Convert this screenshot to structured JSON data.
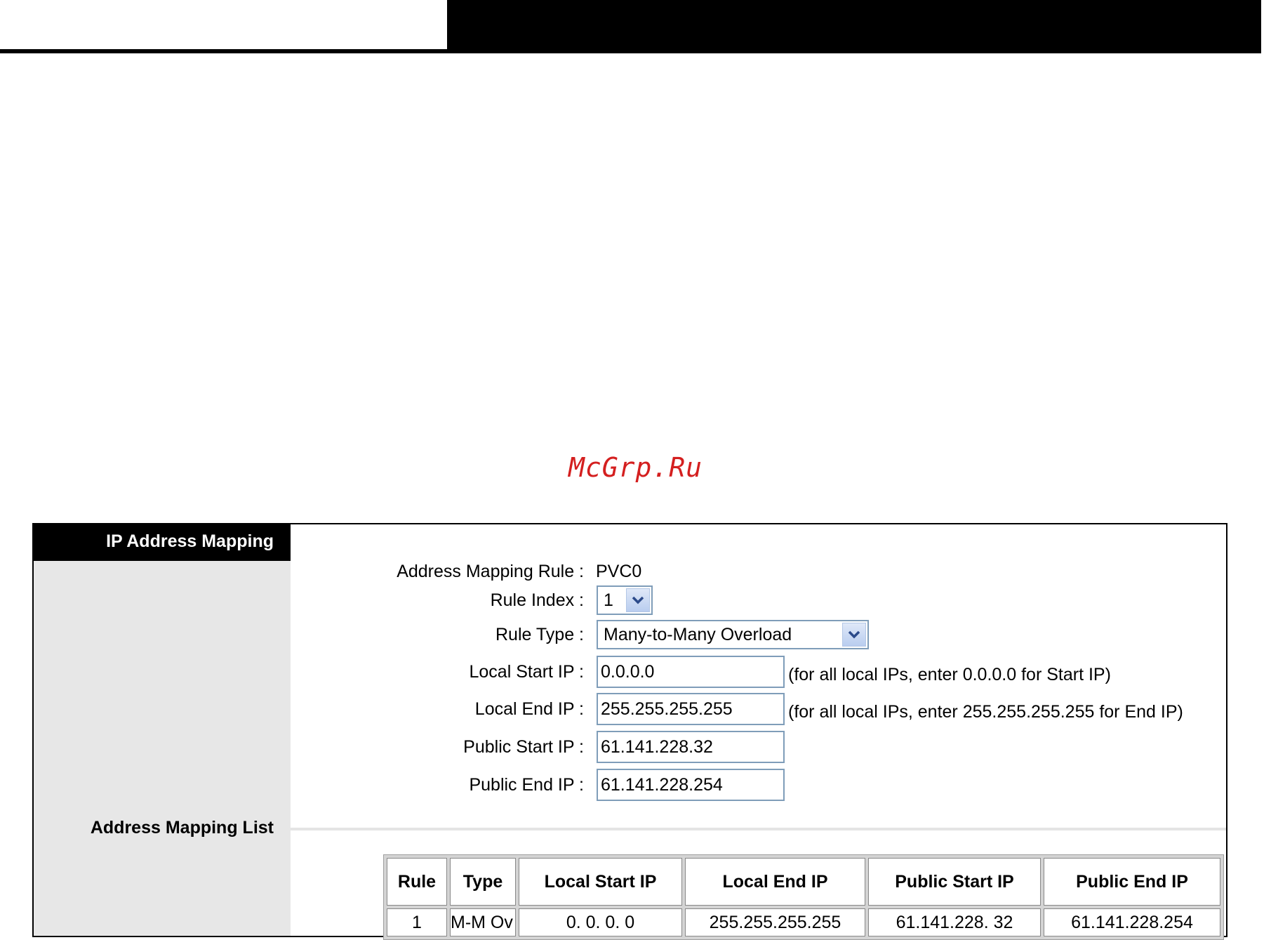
{
  "watermark": "McGrp.Ru",
  "sidebar": {
    "title": "IP Address Mapping",
    "section_label": "Address Mapping List"
  },
  "form": {
    "rule": {
      "label": "Address Mapping Rule :",
      "value": "PVC0"
    },
    "rule_index": {
      "label": "Rule Index :",
      "value": "1"
    },
    "rule_type": {
      "label": "Rule Type :",
      "value": "Many-to-Many Overload"
    },
    "local_start_ip": {
      "label": "Local Start IP :",
      "value": "0.0.0.0",
      "hint": "(for all local IPs, enter 0.0.0.0 for Start IP)"
    },
    "local_end_ip": {
      "label": "Local End IP :",
      "value": "255.255.255.255",
      "hint": "(for all local IPs, enter 255.255.255.255 for End IP)"
    },
    "public_start_ip": {
      "label": "Public Start IP :",
      "value": "61.141.228.32"
    },
    "public_end_ip": {
      "label": "Public End IP :",
      "value": "61.141.228.254"
    }
  },
  "table": {
    "headers": [
      "Rule",
      "Type",
      "Local Start IP",
      "Local End IP",
      "Public Start IP",
      "Public End IP"
    ],
    "rows": [
      [
        "1",
        "M-M Ov",
        "0. 0. 0. 0",
        "255.255.255.255",
        "61.141.228. 32",
        "61.141.228.254"
      ]
    ]
  }
}
